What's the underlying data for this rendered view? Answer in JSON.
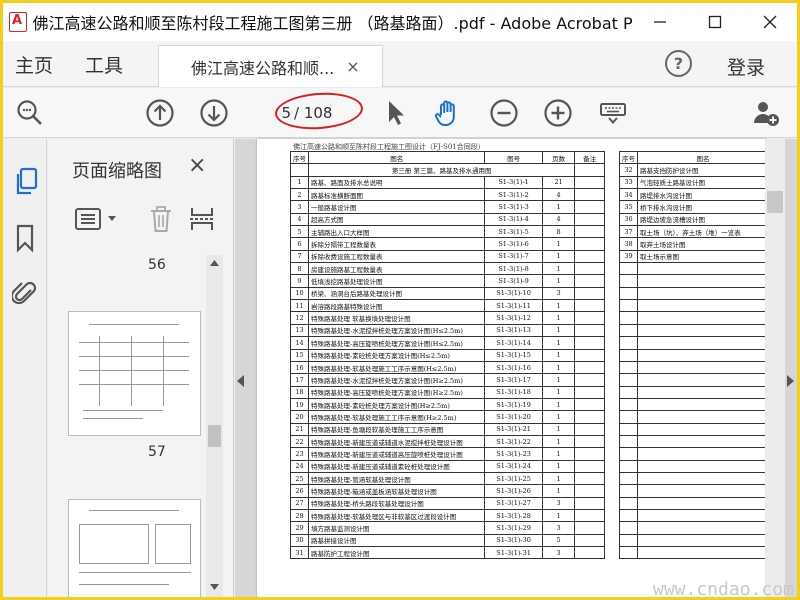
{
  "window": {
    "title": "佛江高速公路和顺至陈村段工程施工图第三册 （路基路面）.pdf - Adobe Acrobat Pr..."
  },
  "menu": {
    "home": "主页",
    "tools": "工具",
    "help_glyph": "?",
    "login": "登录"
  },
  "tab": {
    "label": "佛江高速公路和顺...",
    "close_glyph": "×"
  },
  "toolbar": {
    "page_current": "5",
    "page_total": "/ 108",
    "highlight_color": "#d81e1e"
  },
  "thumbnails": {
    "panel_title": "页面缩略图",
    "close_glyph": "×",
    "pages": [
      "56",
      "57"
    ]
  },
  "document": {
    "header": "佛江高速公路和顺至陈村段工程施工图设计（FJ-S01合同段）",
    "columns": [
      "序号",
      "图名",
      "图号",
      "页数",
      "备注"
    ],
    "right_columns": [
      "序号",
      "图名"
    ],
    "section_heading": "第三册  第三篇、路基及排水通用图",
    "rows": [
      {
        "no": "1",
        "name": "路基、路面及排水总说明",
        "code": "S1-3(1)-1",
        "pages": "21"
      },
      {
        "no": "2",
        "name": "路基标准横断面图",
        "code": "S1-3(1)-2",
        "pages": "4"
      },
      {
        "no": "3",
        "name": "一般路基设计图",
        "code": "S1-3(1)-3",
        "pages": "1"
      },
      {
        "no": "4",
        "name": "超高方式图",
        "code": "S1-3(1)-4",
        "pages": "4"
      },
      {
        "no": "5",
        "name": "主辅路出入口大样图",
        "code": "S1-3(1)-5",
        "pages": "8"
      },
      {
        "no": "6",
        "name": "拆除分隔带工程数量表",
        "code": "S1-3(1)-6",
        "pages": "1"
      },
      {
        "no": "7",
        "name": "拆除收费设施工程数量表",
        "code": "S1-3(1)-7",
        "pages": "1"
      },
      {
        "no": "8",
        "name": "房建设施路基工程数量表",
        "code": "S1-3(1)-8",
        "pages": "1"
      },
      {
        "no": "9",
        "name": "低填浅挖路基处理设计图",
        "code": "S1-3(1)-9",
        "pages": "1"
      },
      {
        "no": "10",
        "name": "桥梁、涵洞台后路基处理设计图",
        "code": "S1-3(1)-10",
        "pages": "3"
      },
      {
        "no": "11",
        "name": "岩溶路段路基特殊设计图",
        "code": "S1-3(1)-11",
        "pages": "1"
      },
      {
        "no": "12",
        "name": "特殊路基处理  软基换填处理设计图",
        "code": "S1-3(1)-12",
        "pages": "1"
      },
      {
        "no": "13",
        "name": "特殊路基处理-水泥搅拌桩处理方案设计图(H≤2.5m)",
        "code": "S1-3(1)-13",
        "pages": "1"
      },
      {
        "no": "14",
        "name": "特殊路基处理-高压旋喷桩处理方案设计图(H≤2.5m)",
        "code": "S1-3(1)-14",
        "pages": "1"
      },
      {
        "no": "15",
        "name": "特殊路基处理-素砼桩处理方案设计图(H≤2.5m)",
        "code": "S1-3(1)-15",
        "pages": "1"
      },
      {
        "no": "16",
        "name": "特殊路基处理-软基处理施工工序示意图(H≤2.5m)",
        "code": "S1-3(1)-16",
        "pages": "1"
      },
      {
        "no": "17",
        "name": "特殊路基处理-水泥搅拌桩处理方案设计图(H≥2.5m)",
        "code": "S1-3(1)-17",
        "pages": "1"
      },
      {
        "no": "18",
        "name": "特殊路基处理-高压旋喷桩处理方案设计图(H≥2.5m)",
        "code": "S1-3(1)-18",
        "pages": "1"
      },
      {
        "no": "19",
        "name": "特殊路基处理-素砼桩处理方案设计图(H≥2.5m)",
        "code": "S1-3(1)-19",
        "pages": "1"
      },
      {
        "no": "20",
        "name": "特殊路基处理-软基处理施工工序示意图(H≥2.5m)",
        "code": "S1-3(1)-20",
        "pages": "1"
      },
      {
        "no": "21",
        "name": "特殊路基处理-鱼塘段软基处理施工工序示意图",
        "code": "S1-3(1)-21",
        "pages": "1"
      },
      {
        "no": "22",
        "name": "特殊路基处理-新建压道或辅道水泥搅拌桩处理设计图",
        "code": "S1-3(1)-22",
        "pages": "1"
      },
      {
        "no": "23",
        "name": "特殊路基处理-新建压道或辅道高压旋喷桩处理设计图",
        "code": "S1-3(1)-23",
        "pages": "1"
      },
      {
        "no": "24",
        "name": "特殊路基处理-新建压道或辅道素砼桩处理设计图",
        "code": "S1-3(1)-24",
        "pages": "1"
      },
      {
        "no": "25",
        "name": "特殊路基处理-管涵软基处理设计图",
        "code": "S1-3(1)-25",
        "pages": "1"
      },
      {
        "no": "26",
        "name": "特殊路基处理-箱涵或盖板涵软基处理设计图",
        "code": "S1-3(1)-26",
        "pages": "1"
      },
      {
        "no": "27",
        "name": "特殊路基处理-桥头路段软基处理设计图",
        "code": "S1-3(1)-27",
        "pages": "3"
      },
      {
        "no": "28",
        "name": "特殊路基处理-软基处理区与非软基区过渡段设计图",
        "code": "S1-3(1)-28",
        "pages": "1"
      },
      {
        "no": "29",
        "name": "填方路基监测设计图",
        "code": "S1-3(1)-29",
        "pages": "3"
      },
      {
        "no": "30",
        "name": "路基拼接设计图",
        "code": "S1-3(1)-30",
        "pages": "5"
      },
      {
        "no": "31",
        "name": "路基防护工程设计图",
        "code": "S1-3(1)-31",
        "pages": "3"
      }
    ],
    "right_rows": [
      {
        "no": "32",
        "name": "路基支挡防护设计图"
      },
      {
        "no": "33",
        "name": "气泡轻质土路基设计图"
      },
      {
        "no": "34",
        "name": "路堤排水沟设计图"
      },
      {
        "no": "35",
        "name": "桥下排水沟设计图"
      },
      {
        "no": "36",
        "name": "路堤边坡急流槽设计图"
      },
      {
        "no": "37",
        "name": "取土场（坑）、弃土场（堆）一览表"
      },
      {
        "no": "38",
        "name": "取弃土场设计图"
      },
      {
        "no": "39",
        "name": "取土场示意图"
      }
    ]
  },
  "watermark": "www.cndao.com"
}
